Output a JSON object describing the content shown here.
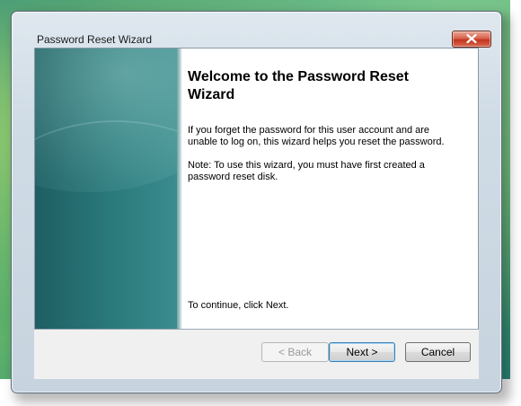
{
  "window": {
    "title": "Password Reset Wizard"
  },
  "content": {
    "heading": "Welcome to the Password Reset Wizard",
    "paragraph1": "If you forget the password for this user account and are unable to log on, this wizard helps you reset the password.",
    "paragraph2": "Note: To use this wizard, you must have first created a password reset disk.",
    "paragraph3": "To continue, click Next."
  },
  "buttons": {
    "back": "< Back",
    "next": "Next >",
    "cancel": "Cancel"
  },
  "icons": {
    "close": "close-icon"
  }
}
